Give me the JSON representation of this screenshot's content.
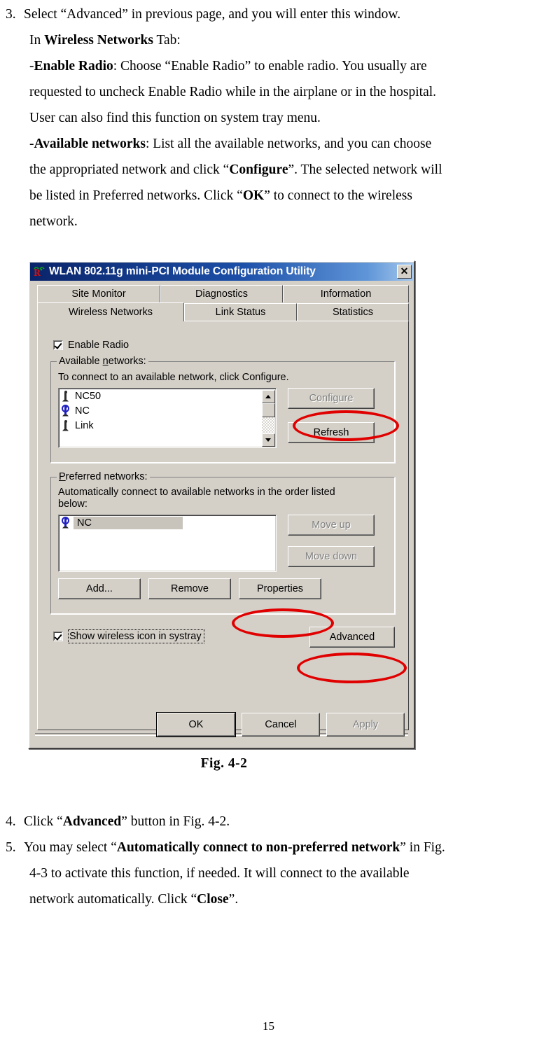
{
  "page": {
    "number": "15"
  },
  "doc": {
    "step3": {
      "number": "3.",
      "line1_a": "Select “Advanced” in previous page, and you will enter this window.",
      "line2_a": "In ",
      "line2_b": "Wireless Networks",
      "line2_c": " Tab:",
      "line3_a": "-",
      "line3_b": "Enable Radio",
      "line3_c": ": Choose “Enable Radio” to enable radio. You usually are",
      "line4": "requested to uncheck Enable Radio while in the airplane or in the hospital.",
      "line5": "User can also find this function on system tray menu.",
      "line6_a": "-",
      "line6_b": "Available networks",
      "line6_c": ": List all the available networks, and you can choose",
      "line7_a": "the appropriated network and click “",
      "line7_b": "Configure",
      "line7_c": "”. The selected network will",
      "line8_a": "be listed in Preferred networks. Click “",
      "line8_b": "OK",
      "line8_c": "” to connect to the wireless",
      "line9": "network."
    },
    "figure_caption": "Fig.  4-2",
    "step4": {
      "number": "4.",
      "line1_a": "Click “",
      "line1_b": "Advanced",
      "line1_c": "” button in Fig. 4-2."
    },
    "step5": {
      "number": "5.",
      "line1_a": "You may select “",
      "line1_b": "Automatically connect to non-preferred network",
      "line1_c": "” in Fig.",
      "line2": "4-3 to activate this function, if needed. It will connect to the available",
      "line3_a": "network automatically. Click “",
      "line3_b": "Close",
      "line3_c": "”."
    }
  },
  "dialog": {
    "title": "WLAN 802.11g mini-PCI Module Configuration Utility",
    "close_label": "✕",
    "tabs_row1": [
      {
        "label": "Site Monitor",
        "selected": false
      },
      {
        "label": "Diagnostics",
        "selected": false
      },
      {
        "label": "Information",
        "selected": false
      }
    ],
    "tabs_row2": [
      {
        "label": "Wireless Networks",
        "selected": true
      },
      {
        "label": "Link Status",
        "selected": false
      },
      {
        "label": "Statistics",
        "selected": false
      }
    ],
    "enable_radio": {
      "label": "Enable Radio",
      "checked": true
    },
    "available_networks": {
      "legend": "Available networks:",
      "legend_pre": "Available ",
      "legend_accel": "n",
      "legend_post": "etworks:",
      "description": "To connect to an available network, click Configure.",
      "items": [
        {
          "name": "NC50",
          "icon": "wireless-tower-icon",
          "active": false
        },
        {
          "name": "NC",
          "icon": "wireless-tower-active-icon",
          "active": true
        },
        {
          "name": "Link",
          "icon": "wireless-tower-icon",
          "active": false
        }
      ],
      "configure_button": {
        "label": "Configure",
        "accel": "C",
        "disabled": true
      },
      "refresh_button": {
        "label": "Refresh",
        "accel": "e",
        "disabled": false
      }
    },
    "preferred_networks": {
      "legend": "Preferred networks:",
      "legend_accel": "P",
      "legend_post": "referred networks:",
      "description_line1": "Automatically connect to available networks in the order listed",
      "description_line2": "below:",
      "items": [
        {
          "name": "NC",
          "icon": "wireless-tower-active-icon",
          "active": true,
          "selected": true
        }
      ],
      "move_up_button": {
        "label": "Move up",
        "accel": "u",
        "disabled": true
      },
      "move_down_button": {
        "label": "Move down",
        "accel": "d",
        "disabled": true
      },
      "add_button": {
        "label": "Add...",
        "accel": "A",
        "disabled": false
      },
      "remove_button": {
        "label": "Remove",
        "accel": "R",
        "disabled": false
      },
      "properties_button": {
        "label": "Properties",
        "accel": "o",
        "disabled": false
      }
    },
    "show_systray": {
      "label": "Show wireless icon in systray",
      "checked": true,
      "focused": true
    },
    "advanced_button": {
      "label": "Advanced",
      "accel": "v",
      "disabled": false
    },
    "ok_button": {
      "label": "OK",
      "default": true,
      "disabled": false
    },
    "cancel_button": {
      "label": "Cancel",
      "disabled": false
    },
    "apply_button": {
      "label": "Apply",
      "accel": "A",
      "disabled": true
    }
  },
  "annotations": {
    "color": "#e00000",
    "targets": [
      "configure-button",
      "properties-button",
      "advanced-button"
    ]
  }
}
